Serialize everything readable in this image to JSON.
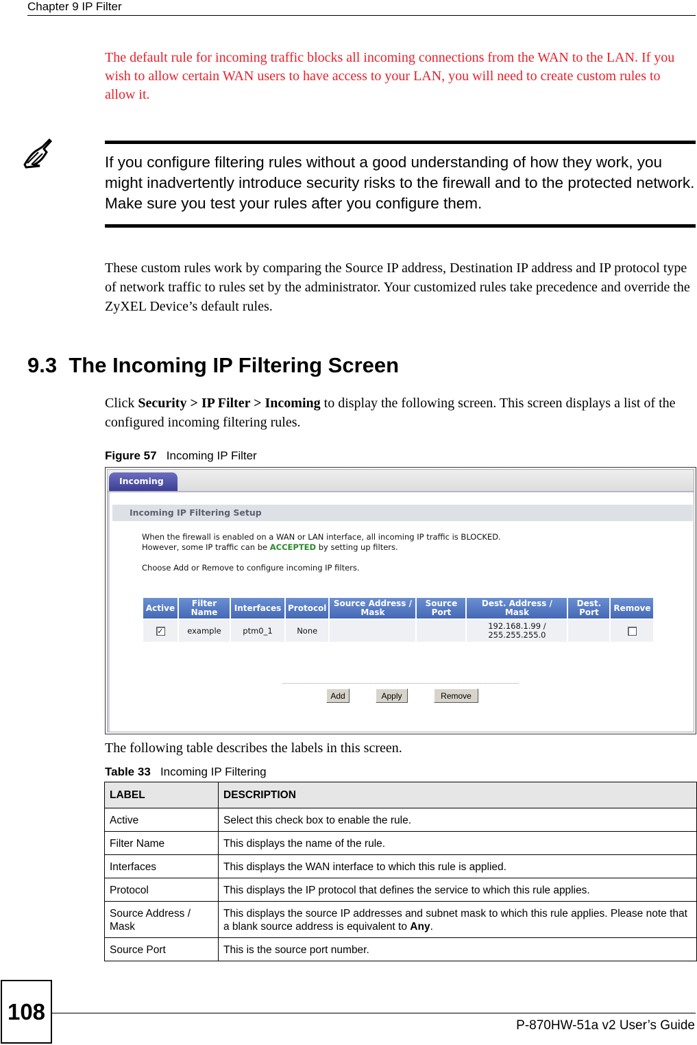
{
  "header": {
    "chapter": "Chapter 9 IP Filter"
  },
  "intro_red": "The default rule for incoming traffic blocks all incoming connections from the WAN to the LAN. If you wish to allow certain WAN users to have access to your LAN, you will need to create custom rules to allow it.",
  "note": {
    "icon": "pencil-note-icon",
    "text": "If you configure filtering rules without a good understanding of how they work, you might inadvertently introduce security risks to the firewall and to the protected network. Make sure you test your rules after you configure them."
  },
  "para_custom_rules": "These custom rules work by comparing the Source IP address, Destination IP address and IP protocol type of network traffic to rules set by the administrator. Your customized rules take precedence and override the ZyXEL Device’s default rules.",
  "section": {
    "number": "9.3",
    "title": "The Incoming IP Filtering Screen"
  },
  "para_click": {
    "prefix": "Click ",
    "path": "Security > IP Filter > Incoming",
    "suffix": " to display the following screen. This screen displays a list of the configured incoming filtering rules."
  },
  "figure": {
    "caption_label": "Figure 57",
    "caption_title": "Incoming IP Filter",
    "tab": "Incoming",
    "setup_title": "Incoming IP Filtering Setup",
    "info_line1": "When the firewall is enabled on a WAN or LAN interface, all incoming IP traffic is BLOCKED.",
    "info_line2_prefix": "However, some IP traffic can be ",
    "info_line2_accent": "ACCEPTED",
    "info_line2_suffix": " by setting up filters.",
    "info_line3": "Choose Add or Remove to configure incoming IP filters.",
    "accent_color": "#2a8a2a",
    "columns": [
      "Active",
      "Filter Name",
      "Interfaces",
      "Protocol",
      "Source Address / Mask",
      "Source Port",
      "Dest. Address / Mask",
      "Dest. Port",
      "Remove"
    ],
    "rows": [
      {
        "active": true,
        "filter_name": "example",
        "interfaces": "ptm0_1",
        "protocol": "None",
        "source_address": "",
        "source_port": "",
        "dest_address_line1": "192.168.1.99 /",
        "dest_address_line2": "255.255.255.0",
        "dest_port": "",
        "remove": false
      }
    ],
    "buttons": {
      "add": "Add",
      "apply": "Apply",
      "remove": "Remove"
    }
  },
  "para_following": "The following table describes the labels in this screen.",
  "table": {
    "caption_label": "Table 33",
    "caption_title": "Incoming IP Filtering",
    "headers": [
      "LABEL",
      "DESCRIPTION"
    ],
    "rows": [
      {
        "label": "Active",
        "description": "Select this check box to enable the rule."
      },
      {
        "label": "Filter Name",
        "description": "This displays the name of the rule."
      },
      {
        "label": "Interfaces",
        "description": "This displays the WAN interface to which this rule is applied."
      },
      {
        "label": "Protocol",
        "description": "This displays the IP protocol that defines the service to which this rule applies."
      },
      {
        "label": "Source Address / Mask",
        "description": "This displays the source IP addresses and subnet mask to which this rule applies. Please note that a blank source address is equivalent to ",
        "description_bold": "Any",
        "description_suffix": "."
      },
      {
        "label": "Source Port",
        "description": "This is the source port number."
      }
    ]
  },
  "footer": {
    "page_number": "108",
    "guide_title": "P-870HW-51a v2 User’s Guide"
  }
}
